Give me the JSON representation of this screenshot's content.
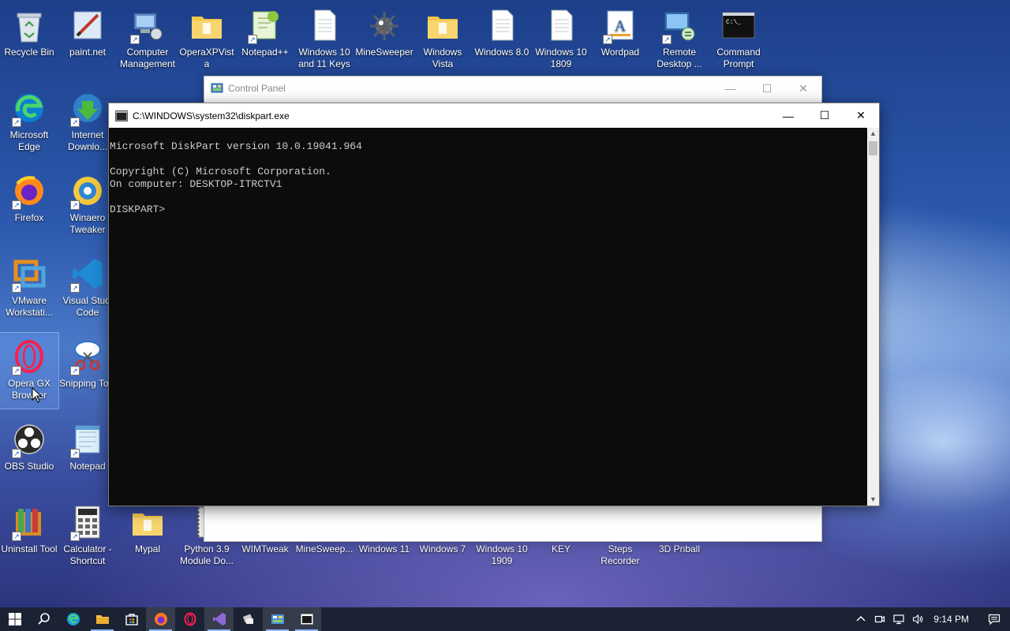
{
  "desktop": {
    "icons_top_row": [
      {
        "label": "Recycle Bin",
        "icon": "recycle-bin-icon"
      },
      {
        "label": "paint.net",
        "icon": "paintnet-icon"
      },
      {
        "label": "Computer Management",
        "icon": "computer-management-icon"
      },
      {
        "label": "OperaXPVista",
        "icon": "folder-icon"
      },
      {
        "label": "Notepad++",
        "icon": "notepadpp-icon"
      },
      {
        "label": "Windows 10 and 11 Keys",
        "icon": "text-file-icon"
      },
      {
        "label": "MineSweeper",
        "icon": "mine-icon"
      },
      {
        "label": "Windows Vista",
        "icon": "folder-icon"
      },
      {
        "label": "Windows 8.0",
        "icon": "text-file-icon"
      },
      {
        "label": "Windows 10 1809",
        "icon": "text-file-icon"
      },
      {
        "label": "Wordpad",
        "icon": "wordpad-icon"
      },
      {
        "label": "Remote Desktop ...",
        "icon": "remote-desktop-icon"
      },
      {
        "label": "Command Prompt",
        "icon": "command-prompt-icon"
      }
    ],
    "icons_left_column": [
      {
        "label": "Microsoft Edge",
        "icon": "edge-icon"
      },
      {
        "label": "Firefox",
        "icon": "firefox-icon"
      },
      {
        "label": "VMware Workstati...",
        "icon": "vmware-icon"
      },
      {
        "label": "Opera GX Browser",
        "icon": "opera-gx-icon"
      },
      {
        "label": "OBS Studio",
        "icon": "obs-icon"
      },
      {
        "label": "Uninstall Tool",
        "icon": "uninstall-tool-icon"
      }
    ],
    "icons_second_column": [
      {
        "label": "Internet Downlo...",
        "icon": "idm-icon"
      },
      {
        "label": "Winaero Tweaker",
        "icon": "winaero-icon"
      },
      {
        "label": "Visual Studi Code",
        "icon": "vscode-icon"
      },
      {
        "label": "Snipping Tool",
        "icon": "snipping-tool-icon"
      },
      {
        "label": "Notepad",
        "icon": "notepad-icon"
      },
      {
        "label": "Calculator - Shortcut",
        "icon": "calculator-icon"
      }
    ],
    "icons_bottom_row": [
      {
        "label": "Mypal",
        "icon": "folder-icon"
      },
      {
        "label": "Python 3.9 Module Do...",
        "icon": "python-doc-icon"
      },
      {
        "label": "WIMTweak",
        "icon": "wimtweak-icon"
      },
      {
        "label": "MineSweep...",
        "icon": "mine-icon"
      },
      {
        "label": "Windows 11",
        "icon": "folder-icon"
      },
      {
        "label": "Windows 7",
        "icon": "folder-icon"
      },
      {
        "label": "Windows 10 1909",
        "icon": "folder-icon"
      },
      {
        "label": "KEY",
        "icon": "key-icon"
      },
      {
        "label": "Steps Recorder",
        "icon": "steps-recorder-icon"
      },
      {
        "label": "3D Pnball",
        "icon": "pinball-icon"
      }
    ]
  },
  "control_panel": {
    "title": "Control Panel",
    "min_glyph": "—",
    "max_glyph": "☐",
    "close_glyph": "✕"
  },
  "console": {
    "title": "C:\\WINDOWS\\system32\\diskpart.exe",
    "lines": [
      "Microsoft DiskPart version 10.0.19041.964",
      "",
      "Copyright (C) Microsoft Corporation.",
      "On computer: DESKTOP-ITRCTV1",
      "",
      "DISKPART> "
    ],
    "min_glyph": "—",
    "max_glyph": "☐",
    "close_glyph": "✕",
    "scroll_up": "▲",
    "scroll_down": "▼"
  },
  "taskbar": {
    "clock": "9:14 PM",
    "accent": "#8fb8ff"
  }
}
